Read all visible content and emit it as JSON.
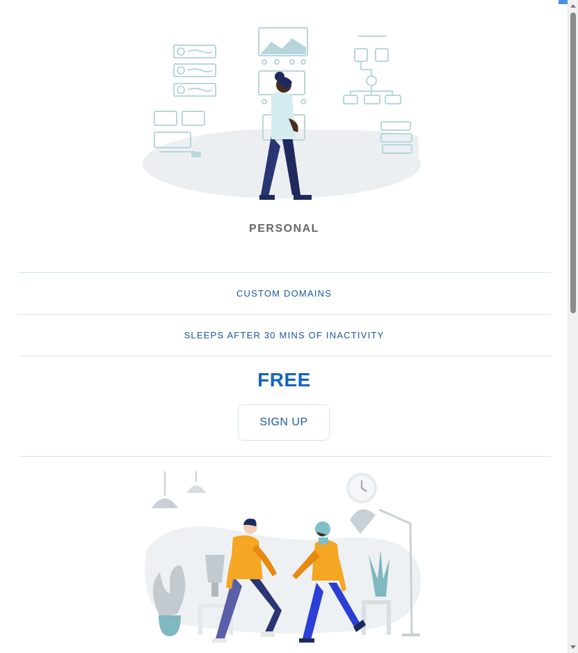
{
  "plan": {
    "name": "PERSONAL",
    "features": [
      {
        "label": "CUSTOM DOMAINS"
      },
      {
        "label": "SLEEPS AFTER 30 MINS OF INACTIVITY"
      }
    ],
    "price": "FREE",
    "cta_label": "SIGN UP"
  },
  "colors": {
    "accent": "#1565c0",
    "link": "#1a56a6",
    "divider": "#d9e7f1",
    "muted_text": "#666666",
    "illustration_teal": "#b7d6dc",
    "orange": "#f5a623",
    "navy": "#1e2a5e"
  },
  "illustrations": {
    "top": "person-browsing-wireframes-illustration",
    "bottom": "two-people-greeting-illustration"
  }
}
